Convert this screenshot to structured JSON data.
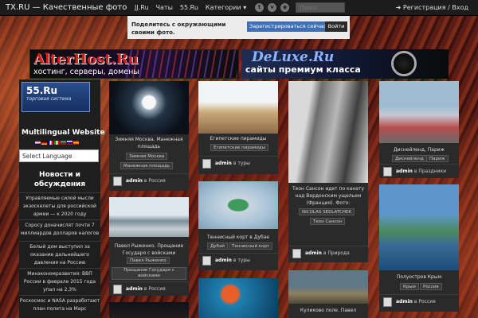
{
  "site": {
    "title": "TX.RU — Качественные фото"
  },
  "nav": [
    "JJ.Ru",
    "Чаты",
    "55.Ru",
    "Категории ▾"
  ],
  "social": [
    "t",
    "v",
    "rss"
  ],
  "search": {
    "placeholder": "Поиск"
  },
  "login": "➜ Регистрация / Вход",
  "share": {
    "text": "Поделитесь с окружающими своими фото.",
    "register": "Зарегистрироваться сейчас",
    "signin": "Войти"
  },
  "banners": {
    "alterhost": {
      "title": "AlterHost.Ru",
      "sub": "хостинг, серверы, домены"
    },
    "deluxe": {
      "title": "DeLuxe.Ru",
      "sub": "сайты премиум класса"
    }
  },
  "sidebar": {
    "logo": "55.Ru",
    "logo_sub": "торговая система",
    "multilingual": "Multilingual Website",
    "language_select": "Select Language",
    "news_title": "Новости и обсуждения",
    "news": [
      "Управляемые силой мысли экзоскелеты для российской армии — к 2020 году",
      "Соросу доначислят почти 7 миллиардов долларов налогов",
      "Белый дом выступил за оказание дальнейшего давления на Россию",
      "Минэкономразвития: ВВП России в феврале 2015 года упал на 2,3%",
      "Роскосмос и NASA разработают план полета на Марс"
    ]
  },
  "posts": {
    "moscow": {
      "caption": "Зимняя Москва. Манежная площадь",
      "tags": [
        "Зимняя Москва",
        "Манежная площадь"
      ],
      "author": "admin",
      "category": "Россия"
    },
    "parade": {
      "caption": "Павел Рыженко. Прощание Государя с войсками",
      "tags": [
        "Павел Рыженко",
        "Прощание Государя с войсками"
      ],
      "author": "admin",
      "category": "Россия"
    },
    "pyramids": {
      "caption": "Египетские пирамиды",
      "tags": [
        "Египетские пирамиды"
      ],
      "author": "admin",
      "category": "туры"
    },
    "tennis": {
      "caption": "Теннисный корт в Дубае",
      "tags": [
        "Дубай",
        "Теннисный корт"
      ],
      "author": "admin",
      "category": "туры"
    },
    "cliff": {
      "caption": "Теон Сансон идет по канату над Вердонским ущельем (Франция). Фото:",
      "tags": [
        "NICOLAS SEDLATCHEK",
        "Теон Сансон"
      ],
      "author": "admin",
      "category": "Природа"
    },
    "kulikovo": {
      "caption": "Куликово поле. Павел"
    },
    "disney": {
      "caption": "Диснейленд, Париж",
      "tags": [
        "Диснейленд",
        "Париж"
      ],
      "author": "admin",
      "category": "Праздники"
    },
    "crimea": {
      "caption": "Полуостров Крым",
      "tags": [
        "Крым",
        "Россия"
      ],
      "author": "admin",
      "category": "Россия"
    }
  },
  "labels": {
    "in": "в"
  }
}
